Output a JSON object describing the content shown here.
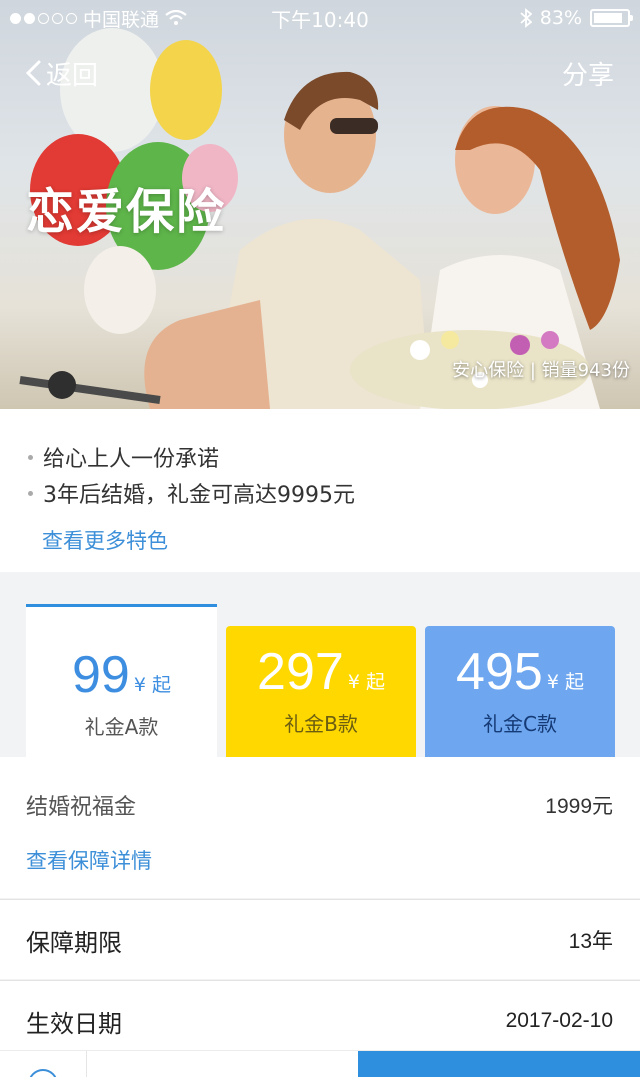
{
  "status_bar": {
    "carrier": "中国联通",
    "time": "下午10:40",
    "battery": "83%",
    "battery_level": 0.83
  },
  "nav": {
    "back_label": "返回",
    "share_label": "分享"
  },
  "hero": {
    "title": "恋爱保险",
    "meta": "安心保险 | 销量943份"
  },
  "features": {
    "items": [
      "给心上人一份承诺",
      "3年后结婚，礼金可高达9995元"
    ],
    "more_link": "查看更多特色"
  },
  "plans": [
    {
      "price": "99",
      "unit": "¥ 起",
      "name": "礼金A款"
    },
    {
      "price": "297",
      "unit": "¥ 起",
      "name": "礼金B款"
    },
    {
      "price": "495",
      "unit": "¥ 起",
      "name": "礼金C款"
    }
  ],
  "benefit": {
    "label": "结婚祝福金",
    "value": "1999元",
    "detail_link": "查看保障详情"
  },
  "term": {
    "label": "保障期限",
    "value": "13年"
  },
  "effective_date": {
    "label": "生效日期",
    "value": "2017-02-10"
  },
  "colors": {
    "accent_blue": "#3c8fd8",
    "plan_b": "#ffd800",
    "plan_c": "#6ea7f0",
    "buy_button": "#2d8fdd"
  }
}
